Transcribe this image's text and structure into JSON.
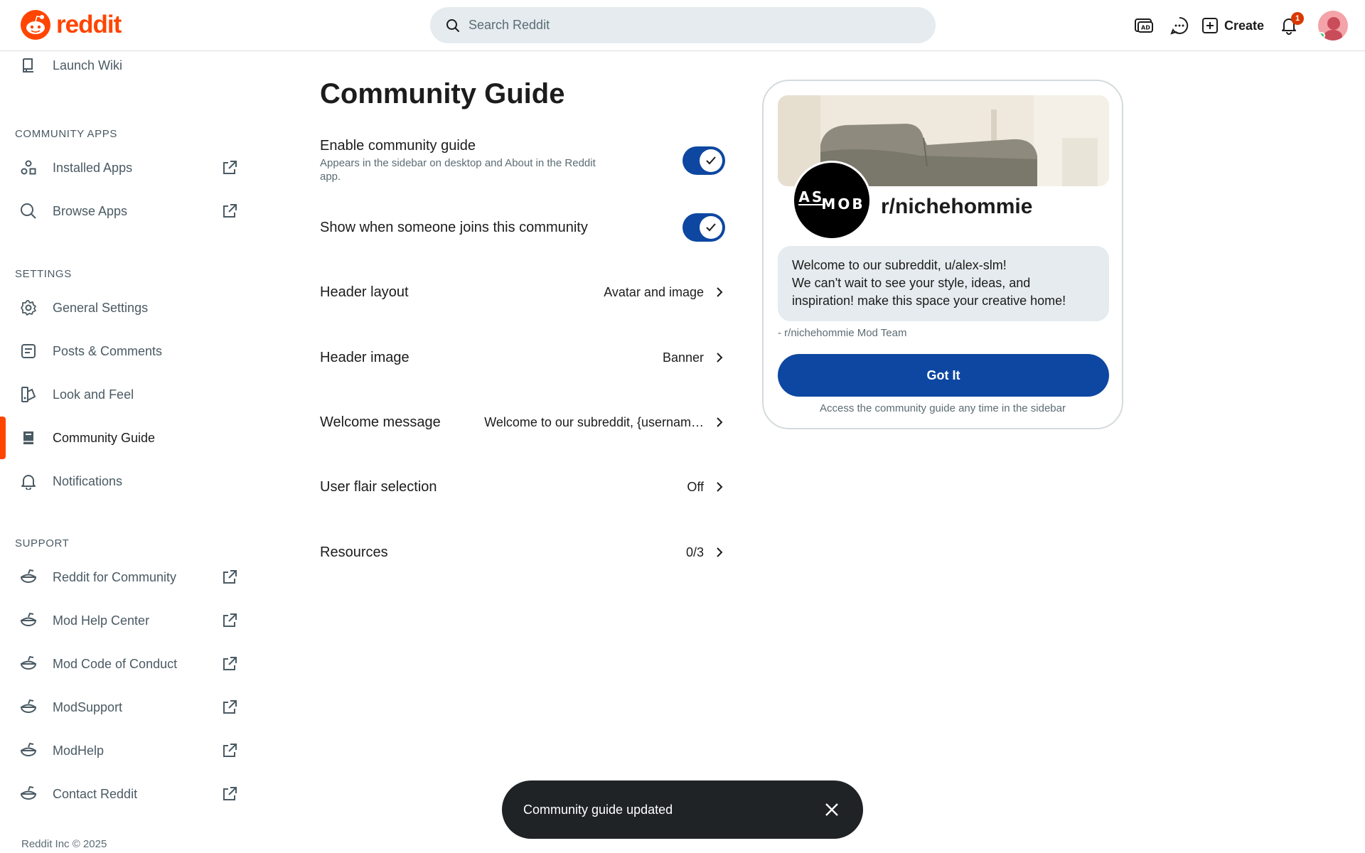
{
  "header": {
    "logo_text": "reddit",
    "search_placeholder": "Search Reddit",
    "create_label": "Create",
    "notification_count": "1",
    "icons": [
      "advertise-icon",
      "chat-icon",
      "create-icon",
      "bell-icon"
    ]
  },
  "sidebar": {
    "top_item": {
      "label": "Launch Wiki",
      "icon": "wiki-icon"
    },
    "community_apps_title": "COMMUNITY APPS",
    "community_apps": [
      {
        "label": "Installed Apps",
        "icon": "apps-icon"
      },
      {
        "label": "Browse Apps",
        "icon": "search-icon"
      }
    ],
    "settings_title": "SETTINGS",
    "settings": [
      {
        "label": "General Settings",
        "icon": "gear-icon"
      },
      {
        "label": "Posts & Comments",
        "icon": "posts-icon"
      },
      {
        "label": "Look and Feel",
        "icon": "paint-icon"
      },
      {
        "label": "Community Guide",
        "icon": "guide-icon"
      },
      {
        "label": "Notifications",
        "icon": "bell-icon"
      }
    ],
    "support_title": "SUPPORT",
    "support": [
      {
        "label": "Reddit for Community",
        "icon": "snoo-icon"
      },
      {
        "label": "Mod Help Center",
        "icon": "snoo-icon"
      },
      {
        "label": "Mod Code of Conduct",
        "icon": "snoo-icon"
      },
      {
        "label": "ModSupport",
        "icon": "snoo-icon"
      },
      {
        "label": "ModHelp",
        "icon": "snoo-icon"
      },
      {
        "label": "Contact Reddit",
        "icon": "snoo-icon"
      }
    ],
    "copyright": "Reddit Inc © 2025"
  },
  "main": {
    "title": "Community Guide",
    "enable_guide": {
      "label": "Enable community guide",
      "sublabel": "Appears in the sidebar on desktop and About in the Reddit app.",
      "enabled": true
    },
    "show_joins": {
      "label": "Show when someone joins this community",
      "enabled": true
    },
    "rows": [
      {
        "label": "Header layout",
        "value": "Avatar and image"
      },
      {
        "label": "Header image",
        "value": "Banner"
      },
      {
        "label": "Welcome message",
        "value": "Welcome to our subreddit, {usernam…"
      },
      {
        "label": "User flair selection",
        "value": "Off"
      },
      {
        "label": "Resources",
        "value": "0/3"
      }
    ]
  },
  "preview": {
    "avatar_text_top": "AS",
    "avatar_text_bottom": "MOB",
    "community_name": "r/nichehommie",
    "welcome_line1": "Welcome to our subreddit, u/alex-slm!",
    "welcome_line2": "We can't wait to see your style, ideas, and",
    "welcome_line3": "inspiration! make this space your creative home!",
    "mod_team": "- r/nichehommie Mod Team",
    "button_label": "Got It",
    "access_note": "Access the community guide any time in the sidebar"
  },
  "toast": {
    "message": "Community guide updated"
  },
  "colors": {
    "brand": "#ff4500",
    "toggle_on": "#0d47a1",
    "button": "#0d47a1",
    "toast_bg": "#1f2325"
  }
}
